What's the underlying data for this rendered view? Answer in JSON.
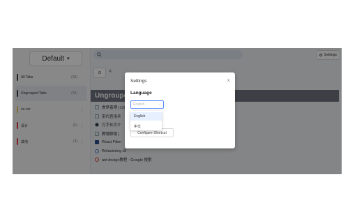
{
  "workspace": {
    "name": "Default",
    "chevron": "▾"
  },
  "sidebar": {
    "items": [
      {
        "label": "All Tabs",
        "count": "(15)",
        "color": "#444444"
      },
      {
        "label": "Ungrouped Tabs",
        "count": "(15)",
        "color": "#444444",
        "active": true
      },
      {
        "label": "vo-ver",
        "count": "",
        "color": "#e9c46a"
      },
      {
        "label": "设计",
        "count": "(5)",
        "color": "#e63946"
      },
      {
        "label": "其他",
        "count": "(4)",
        "color": "#e63946"
      }
    ]
  },
  "search": {
    "placeholder": ""
  },
  "settings_button": {
    "label": "Settings"
  },
  "toolbar": {
    "label": "A"
  },
  "group": {
    "title": "Ungroupe"
  },
  "tabs": [
    {
      "title": "食梦者博 (13)"
    },
    {
      "title": "宋代官用兵"
    },
    {
      "title": "万字长文介"
    },
    {
      "title": "腾哦聊哦 |"
    },
    {
      "title": "React Fiber"
    },
    {
      "title": "Refactoring UI"
    },
    {
      "title": "ant design教程 - Google 搜索"
    }
  ],
  "modal": {
    "title": "Settings",
    "language_label": "Language",
    "select_placeholder": "English",
    "options": [
      "English",
      "中文"
    ],
    "shortcut_button": "Configure Shortcut"
  },
  "colors": {
    "accent": "#5b8ff9",
    "group_header": "#6f7480"
  }
}
